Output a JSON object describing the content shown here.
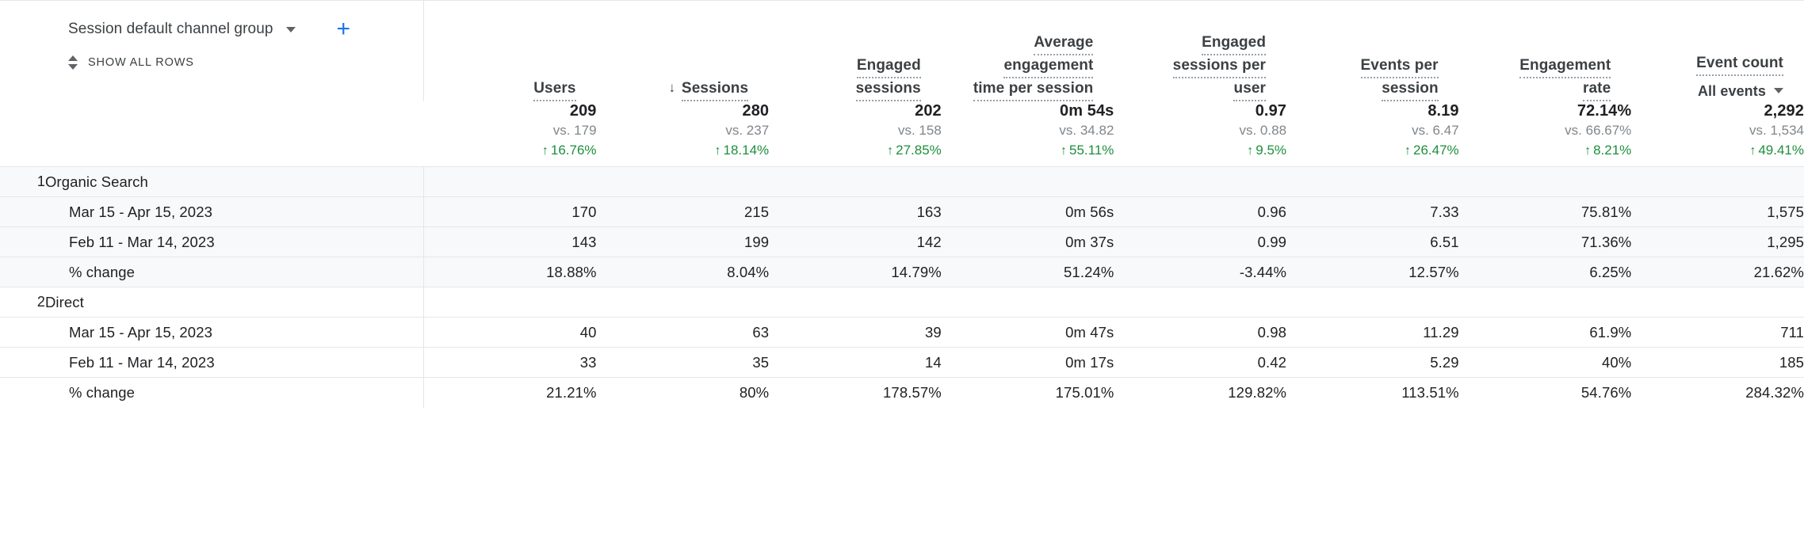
{
  "dimension": {
    "label": "Session default channel group",
    "dropdown_icon": "chevron-down-icon",
    "add_icon": "plus-icon",
    "add_label": "+",
    "show_all_rows_label": "SHOW ALL ROWS",
    "show_all_rows_icon": "sort-updown-icon"
  },
  "colors": {
    "positive": "#1e8e3e",
    "accent": "#1a73e8",
    "text": "#202124",
    "muted": "#80868b",
    "border": "#e4e6e8",
    "row_shade": "#f8f9fa"
  },
  "columns": [
    {
      "id": "users",
      "lines": [
        "Users"
      ],
      "sorted": false,
      "sort_icon": ""
    },
    {
      "id": "sessions",
      "lines": [
        "Sessions"
      ],
      "sorted": true,
      "sort_icon": "↓"
    },
    {
      "id": "engaged_sessions",
      "lines": [
        "Engaged",
        "sessions"
      ],
      "sorted": false,
      "sort_icon": ""
    },
    {
      "id": "avg_engagement",
      "lines": [
        "Average",
        "engagement",
        "time per session"
      ],
      "sorted": false,
      "sort_icon": ""
    },
    {
      "id": "eng_per_user",
      "lines": [
        "Engaged",
        "sessions per",
        "user"
      ],
      "sorted": false,
      "sort_icon": ""
    },
    {
      "id": "events_per_sess",
      "lines": [
        "Events per",
        "session"
      ],
      "sorted": false,
      "sort_icon": ""
    },
    {
      "id": "engagement_rate",
      "lines": [
        "Engagement",
        "rate"
      ],
      "sorted": false,
      "sort_icon": ""
    },
    {
      "id": "event_count",
      "lines": [
        "Event count"
      ],
      "sorted": false,
      "sort_icon": "",
      "sublabel": "All events",
      "sublabel_icon": "chevron-down-icon"
    }
  ],
  "summary": [
    {
      "value": "209",
      "vs": "vs. 179",
      "delta": "16.76%",
      "direction": "up"
    },
    {
      "value": "280",
      "vs": "vs. 237",
      "delta": "18.14%",
      "direction": "up"
    },
    {
      "value": "202",
      "vs": "vs. 158",
      "delta": "27.85%",
      "direction": "up"
    },
    {
      "value": "0m 54s",
      "vs": "vs. 34.82",
      "delta": "55.11%",
      "direction": "up"
    },
    {
      "value": "0.97",
      "vs": "vs. 0.88",
      "delta": "9.5%",
      "direction": "up"
    },
    {
      "value": "8.19",
      "vs": "vs. 6.47",
      "delta": "26.47%",
      "direction": "up"
    },
    {
      "value": "72.14%",
      "vs": "vs. 66.67%",
      "delta": "8.21%",
      "direction": "up"
    },
    {
      "value": "2,292",
      "vs": "vs. 1,534",
      "delta": "49.41%",
      "direction": "up"
    }
  ],
  "rows": [
    {
      "type": "group",
      "index": "1",
      "label": "Organic Search",
      "shaded": true,
      "values": [
        "",
        "",
        "",
        "",
        "",
        "",
        "",
        ""
      ]
    },
    {
      "type": "data",
      "index": "",
      "label": "Mar 15 - Apr 15, 2023",
      "shaded": true,
      "values": [
        "170",
        "215",
        "163",
        "0m 56s",
        "0.96",
        "7.33",
        "75.81%",
        "1,575"
      ]
    },
    {
      "type": "data",
      "index": "",
      "label": "Feb 11 - Mar 14, 2023",
      "shaded": true,
      "values": [
        "143",
        "199",
        "142",
        "0m 37s",
        "0.99",
        "6.51",
        "71.36%",
        "1,295"
      ]
    },
    {
      "type": "data",
      "index": "",
      "label": "% change",
      "shaded": true,
      "values": [
        "18.88%",
        "8.04%",
        "14.79%",
        "51.24%",
        "-3.44%",
        "12.57%",
        "6.25%",
        "21.62%"
      ]
    },
    {
      "type": "group",
      "index": "2",
      "label": "Direct",
      "shaded": false,
      "values": [
        "",
        "",
        "",
        "",
        "",
        "",
        "",
        ""
      ]
    },
    {
      "type": "data",
      "index": "",
      "label": "Mar 15 - Apr 15, 2023",
      "shaded": false,
      "values": [
        "40",
        "63",
        "39",
        "0m 47s",
        "0.98",
        "11.29",
        "61.9%",
        "711"
      ]
    },
    {
      "type": "data",
      "index": "",
      "label": "Feb 11 - Mar 14, 2023",
      "shaded": false,
      "values": [
        "33",
        "35",
        "14",
        "0m 17s",
        "0.42",
        "5.29",
        "40%",
        "185"
      ]
    },
    {
      "type": "data",
      "index": "",
      "label": "% change",
      "shaded": false,
      "values": [
        "21.21%",
        "80%",
        "178.57%",
        "175.01%",
        "129.82%",
        "113.51%",
        "54.76%",
        "284.32%"
      ]
    }
  ]
}
